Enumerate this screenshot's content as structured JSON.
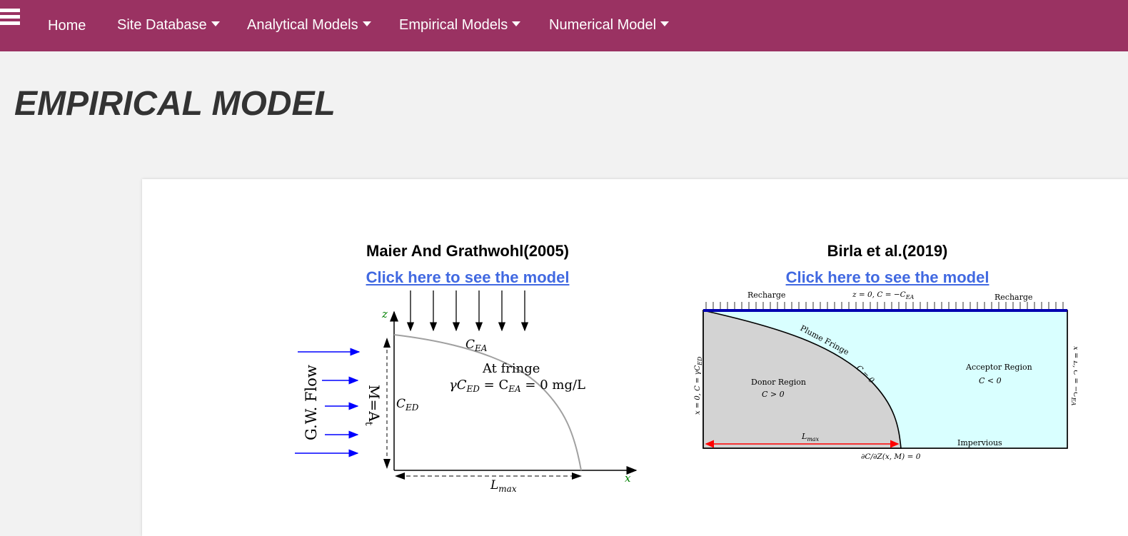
{
  "nav": {
    "home": "Home",
    "items": [
      {
        "label": "Site Database"
      },
      {
        "label": "Analytical Models"
      },
      {
        "label": "Empirical Models"
      },
      {
        "label": "Numerical Model"
      }
    ]
  },
  "page": {
    "title": "EMPIRICAL MODEL"
  },
  "models": [
    {
      "title": "Maier And Grathwohl(2005)",
      "link": "Click here to see the model",
      "figure": {
        "z_axis": "z",
        "x_axis": "x",
        "c_ea": "C",
        "c_ea_sub": "EA",
        "fringe": "At fringe",
        "equation_gamma": "γC",
        "equation_ed_sub": "ED",
        "equation_eq": " = C",
        "equation_ea_sub": "EA",
        "equation_tail": " = 0 mg/L",
        "c_ed": "C",
        "c_ed_sub": "ED",
        "flow": "G.W. Flow",
        "m_label": "M=A",
        "m_sub": "t",
        "lmax": "L",
        "lmax_sub": "max"
      }
    },
    {
      "title": "Birla et al.(2019)",
      "link": "Click here to see the model",
      "figure": {
        "recharge_left": "Recharge",
        "recharge_right": "Recharge",
        "top_bc": "z = 0, C = −C",
        "top_bc_sub": "EA",
        "plume_fringe": "Plume Fringe",
        "c_zero": "C = 0",
        "donor": "Donor Region",
        "donor_cond": "C > 0",
        "acceptor": "Acceptor Region",
        "acceptor_cond": "C < 0",
        "left_bc": "x = 0, C = γC",
        "left_bc_sub": "ED",
        "right_bc": "x = L, C = −C",
        "right_bc_sub": "EA",
        "lmax": "L",
        "lmax_sub": "max",
        "impervious": "Impervious",
        "bottom_bc": "∂C/∂Z(x, M) = 0"
      }
    }
  ],
  "colors": {
    "navbar": "#9a3262",
    "link": "#4169e1",
    "flow_arrow": "#0000ff",
    "acceptor_fill": "#d9ffff",
    "donor_fill": "#d3d3d3",
    "recharge_bar": "#0000b0",
    "lmax_arrow": "#ff0000",
    "axis_label": "#008000"
  }
}
